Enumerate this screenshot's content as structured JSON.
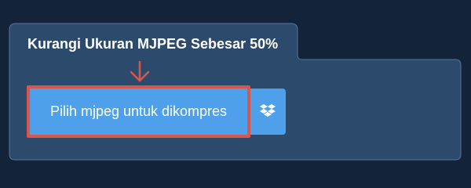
{
  "panel": {
    "title": "Kurangi Ukuran MJPEG Sebesar 50%"
  },
  "upload": {
    "button_label": "Pilih mjpeg untuk dikompres",
    "dropbox_icon": "dropbox-icon",
    "pointer_icon": "arrow-down-icon"
  },
  "colors": {
    "page_background": "#12233a",
    "panel_background": "#2c4a6b",
    "button_background": "#4fa0ea",
    "highlight_border": "#d9564a"
  }
}
